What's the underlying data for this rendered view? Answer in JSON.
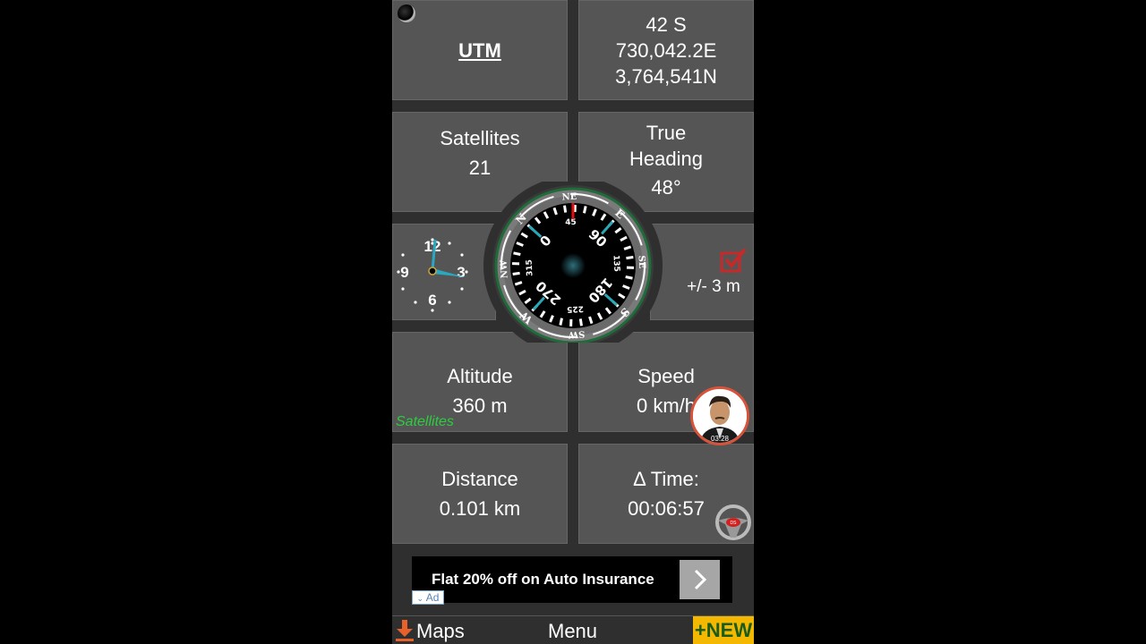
{
  "tiles": {
    "utm": {
      "label": "UTM"
    },
    "coordinates": {
      "zone": "42 S",
      "easting": "730,042.2E",
      "northing": "3,764,541N"
    },
    "satellites": {
      "label": "Satellites",
      "value": "21"
    },
    "heading": {
      "label_line1": "True",
      "label_line2": "Heading",
      "value": "48°"
    },
    "accuracy": {
      "value": "+/- 3 m"
    },
    "altitude": {
      "label": "Altitude",
      "value": "360 m",
      "source": "Satellites"
    },
    "speed": {
      "label": "Speed",
      "value": "0 km/h"
    },
    "distance": {
      "label": "Distance",
      "value": "0.101 km"
    },
    "time": {
      "label": "Δ Time:",
      "value": "00:06:57"
    }
  },
  "compass": {
    "heading_deg": 48,
    "cardinals": [
      "N",
      "NE",
      "E",
      "SE",
      "S",
      "SW",
      "W",
      "NW"
    ],
    "degree_labels": [
      "0",
      "45",
      "90",
      "135",
      "180",
      "225",
      "270",
      "315"
    ],
    "colors": {
      "ring": "#1f6b3a",
      "needle": "#e01010",
      "major_tick": "#e8d020",
      "diag_tick": "#2aa8b8"
    }
  },
  "clock": {
    "hour_labels": [
      "12",
      "3",
      "6",
      "9"
    ],
    "hour": 3,
    "minute": 0
  },
  "overlay": {
    "avatar_timestamp": "03:28",
    "steering_badge": "DS"
  },
  "ad": {
    "text": "Flat 20% off on Auto Insurance",
    "badge": "Ad"
  },
  "bottom_bar": {
    "maps_label": "Maps",
    "menu_label": "Menu",
    "new_label": "+NEW"
  }
}
